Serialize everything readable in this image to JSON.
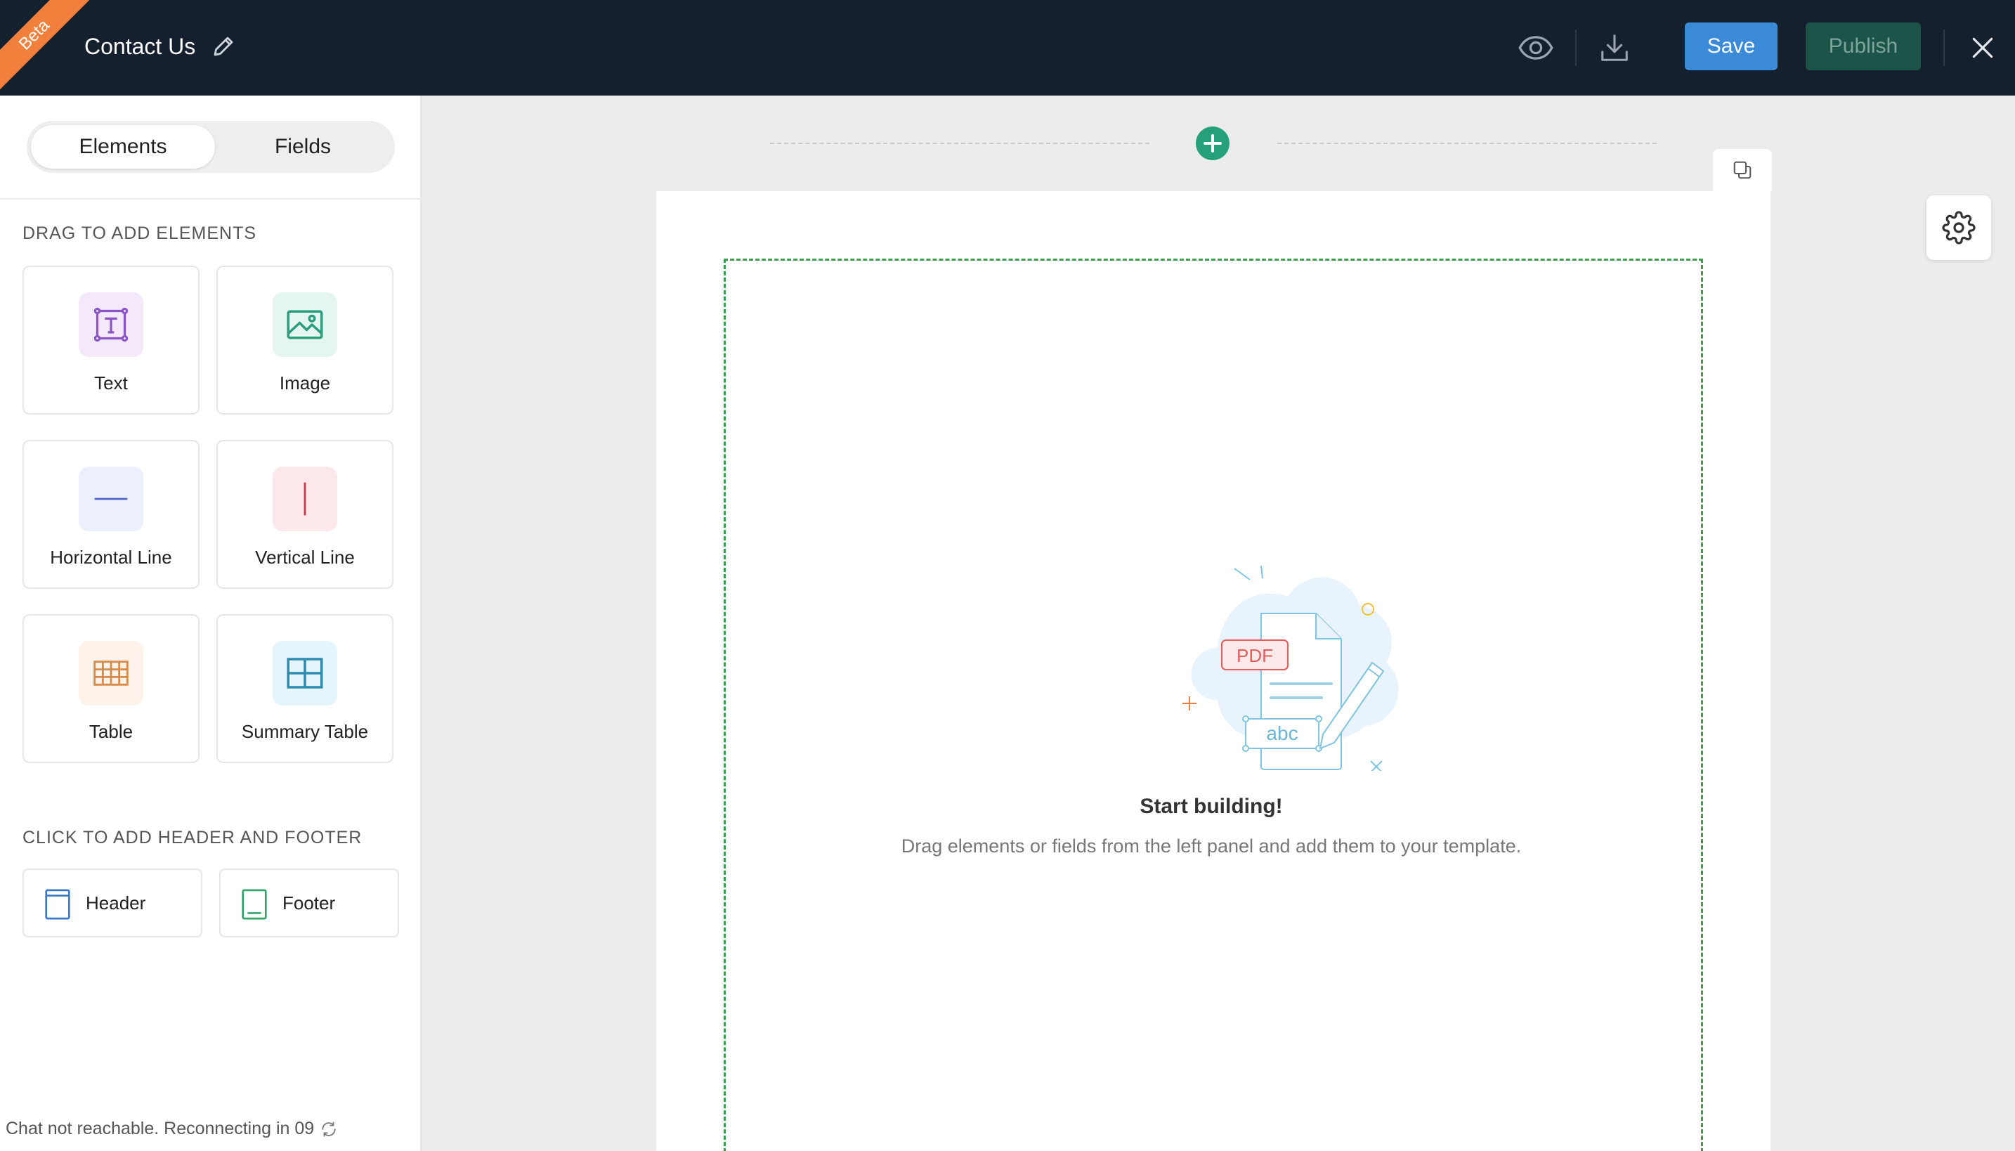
{
  "header": {
    "beta_label": "Beta",
    "title": "Contact Us",
    "save_label": "Save",
    "publish_label": "Publish",
    "colors": {
      "bar": "#14202e",
      "save": "#3a8ad8",
      "publish": "#1c5449",
      "beta": "#f0803c"
    }
  },
  "sidebar": {
    "tabs": [
      {
        "label": "Elements",
        "active": true
      },
      {
        "label": "Fields",
        "active": false
      }
    ],
    "drag_section_label": "DRAG TO ADD ELEMENTS",
    "elements": [
      {
        "label": "Text",
        "icon": "text-box-icon",
        "color": "#8b55c8"
      },
      {
        "label": "Image",
        "icon": "image-icon",
        "color": "#2a9d7c"
      },
      {
        "label": "Horizontal Line",
        "icon": "horizontal-line-icon",
        "color": "#4f64c4"
      },
      {
        "label": "Vertical Line",
        "icon": "vertical-line-icon",
        "color": "#c4364a"
      },
      {
        "label": "Table",
        "icon": "table-icon",
        "color": "#d88a48"
      },
      {
        "label": "Summary Table",
        "icon": "summary-table-icon",
        "color": "#2c8ab0"
      }
    ],
    "header_footer_label": "CLICK TO ADD HEADER AND FOOTER",
    "header_footer": [
      {
        "label": "Header",
        "icon": "header-icon",
        "color": "#3a78c9"
      },
      {
        "label": "Footer",
        "icon": "footer-icon",
        "color": "#34a56a"
      }
    ],
    "status": "Chat not reachable. Reconnecting in 09"
  },
  "canvas": {
    "empty_title": "Start building!",
    "empty_subtitle": "Drag elements or fields from the left panel and add them to your template.",
    "illustration_texts": {
      "pdf": "PDF",
      "abc": "abc"
    }
  }
}
